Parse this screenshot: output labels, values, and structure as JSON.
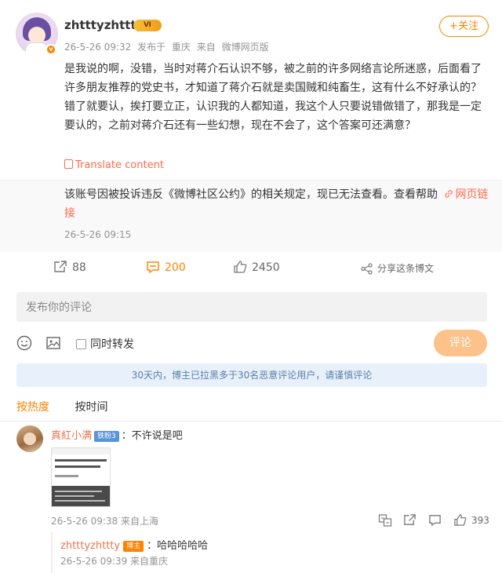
{
  "post": {
    "username": "zhtttyzhttty",
    "vip_label": "Ⅵ",
    "avatar_badge": "v",
    "meta": {
      "time": "26-5-26 09:32",
      "publish_prefix": "发布于",
      "location": "重庆",
      "source_prefix": "来自",
      "source": "微博网页版"
    },
    "follow_label": "+关注",
    "content": "是我说的啊，没错，当时对蒋介石认识不够，被之前的许多网络言论所迷惑，后面看了许多朋友推荐的党史书，才知道了蒋介石就是卖国贼和纯畜生，这有什么不好承认的？错了就要认，挨打要立正，认识我的人都知道，我这个人只要说错做错了，那我是一定要认的，之前对蒋介石还有一些幻想，现在不会了，这个答案可还满意？",
    "translate_label": "Translate content"
  },
  "notice": {
    "text": "该账号因被投诉违反《微博社区公约》的相关规定，现已无法查看。查看帮助",
    "link_label": "网页链接",
    "time": "26-5-26 09:15"
  },
  "actions": {
    "repost_count": "88",
    "comment_count": "200",
    "like_count": "2450",
    "share_label": "分享这条博文"
  },
  "composer": {
    "placeholder": "发布你的评论",
    "repost_label": "同时转发",
    "submit_label": "评论"
  },
  "warning": "30天内，博主已拉黑多于30名恶意评论用户，请谨慎评论",
  "sort": {
    "hot": "按热度",
    "time": "按时间"
  },
  "comment": {
    "name": "真紅小满",
    "badge": "铁粉3",
    "text": "：不许说是吧",
    "meta": "26-5-26 09:38 来自上海",
    "like_count": "393"
  },
  "reply": {
    "name": "zhtttyzhttty",
    "badge": "博主",
    "text": "：哈哈哈哈哈",
    "meta": "26-5-26 09:39 来自重庆"
  },
  "colors": {
    "accent": "#ff8200",
    "link": "#ff6a4d",
    "name": "#eb7350"
  }
}
